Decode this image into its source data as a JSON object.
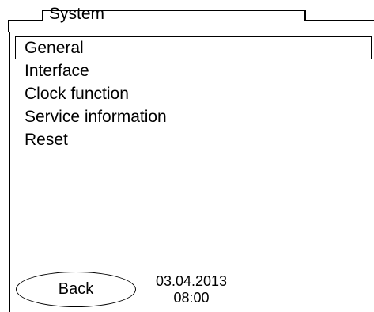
{
  "header": {
    "title": "System"
  },
  "menu": {
    "items": [
      {
        "label": "General",
        "selected": true
      },
      {
        "label": "Interface",
        "selected": false
      },
      {
        "label": "Clock function",
        "selected": false
      },
      {
        "label": "Service information",
        "selected": false
      },
      {
        "label": "Reset",
        "selected": false
      }
    ]
  },
  "footer": {
    "back_label": "Back",
    "date": "03.04.2013",
    "time": "08:00"
  }
}
